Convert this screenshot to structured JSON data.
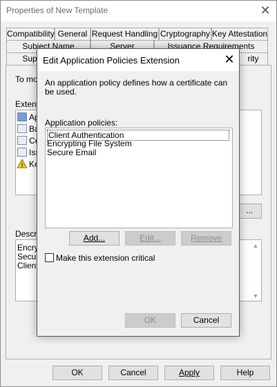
{
  "parent": {
    "title": "Properties of New Template",
    "tabs_row1": [
      "Compatibility",
      "General",
      "Request Handling",
      "Cryptography",
      "Key Attestation"
    ],
    "tabs_row2": [
      "Subject Name",
      "Server",
      "Issuance Requirements"
    ],
    "tabs_row3_left": "Sup",
    "tabs_row3_right": "rity",
    "intro_fragment": "To mo",
    "extensions_label_fragment": "Extens",
    "extension_items": [
      "Ap",
      "Ba",
      "Ce",
      "Iss",
      "Ke"
    ],
    "edit_button_fragment": "...",
    "description_label_fragment": "Descrip",
    "description_lines": [
      "Encryp",
      "Secur",
      "Client"
    ],
    "buttons": {
      "ok": "OK",
      "cancel": "Cancel",
      "apply": "Apply",
      "help": "Help"
    }
  },
  "dialog": {
    "title": "Edit Application Policies Extension",
    "description": "An application policy defines how a certificate can be used.",
    "policies_label": "Application policies:",
    "policies": [
      "Client Authentication",
      "Encrypting File System",
      "Secure Email"
    ],
    "selected_policy": "Client Authentication",
    "add_label": "Add...",
    "edit_label": "Edit...",
    "remove_label": "Remove",
    "critical_label": "Make this extension critical",
    "critical_checked": false,
    "ok_label": "OK",
    "cancel_label": "Cancel"
  }
}
